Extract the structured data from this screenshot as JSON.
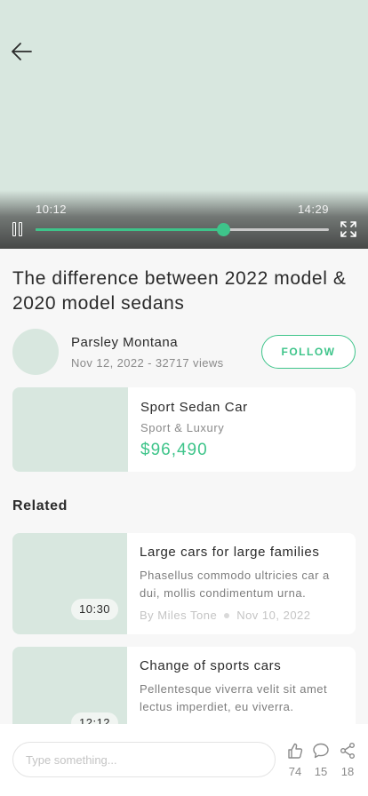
{
  "video": {
    "current_time": "10:12",
    "duration": "14:29",
    "progress": 0.638
  },
  "title": "The difference between 2022 model & 2020 model sedans",
  "author": {
    "name": "Parsley Montana",
    "meta": "Nov 12, 2022 - 32717 views",
    "follow_label": "FOLLOW"
  },
  "product": {
    "name": "Sport Sedan Car",
    "category": "Sport & Luxury",
    "price": "$96,490"
  },
  "related": {
    "heading": "Related",
    "items": [
      {
        "duration": "10:30",
        "title": "Large cars for large families",
        "description": "Phasellus commodo ultricies car a dui, mollis condimentum urna.",
        "author": "By Miles Tone",
        "date": "Nov 10, 2022"
      },
      {
        "duration": "12:12",
        "title": "Change of sports cars",
        "description": "Pellentesque viverra velit sit amet lectus imperdiet, eu viverra."
      }
    ]
  },
  "bottom_bar": {
    "placeholder": "Type something...",
    "likes": "74",
    "comments": "15",
    "shares": "18"
  },
  "colors": {
    "accent": "#3ec48a",
    "placeholder": "#d8e7df"
  }
}
